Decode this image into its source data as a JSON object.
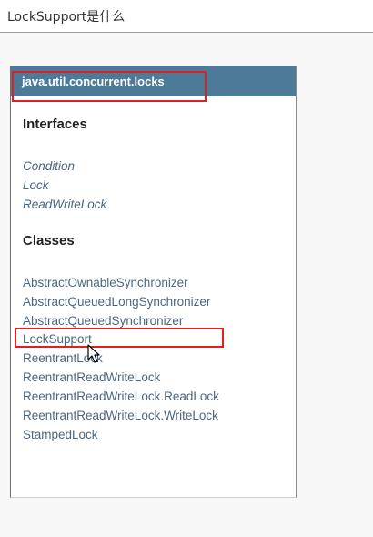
{
  "window": {
    "title": "LockSupport是什么"
  },
  "package": {
    "name": "java.util.concurrent.locks"
  },
  "interfaces": {
    "heading": "Interfaces",
    "items": [
      "Condition",
      "Lock",
      "ReadWriteLock"
    ]
  },
  "classes": {
    "heading": "Classes",
    "items": [
      "AbstractOwnableSynchronizer",
      "AbstractQueuedLongSynchronizer",
      "AbstractQueuedSynchronizer",
      "LockSupport",
      "ReentrantLock",
      "ReentrantReadWriteLock",
      "ReentrantReadWriteLock.ReadLock",
      "ReentrantReadWriteLock.WriteLock",
      "StampedLock"
    ]
  },
  "colors": {
    "header_bg": "#4d7a97",
    "link": "#4a6782",
    "highlight": "#e02020"
  },
  "icons": {
    "cursor": "mouse-pointer-icon"
  }
}
